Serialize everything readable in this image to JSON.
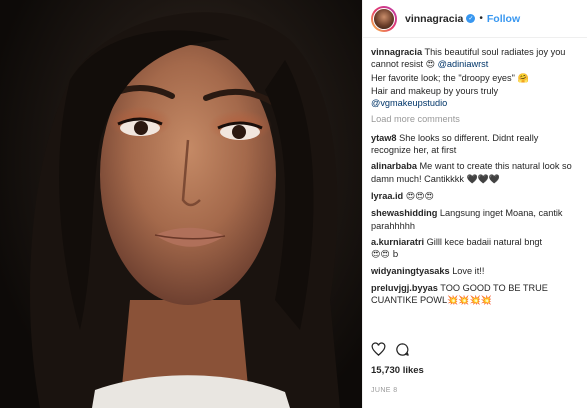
{
  "photo": {
    "alt": "portrait"
  },
  "header": {
    "username": "vinnagracia",
    "dot": "•",
    "follow": "Follow"
  },
  "caption": {
    "username": "vinnagracia",
    "line1": " This beautiful soul radiates joy you cannot resist ",
    "emoji1": "😍",
    "mention": "@adiniawrst",
    "line2": "Her favorite look; the \"droopy eyes\" ",
    "emoji2": "🤗",
    "line3": "Hair and makeup by yours truly",
    "studio": "@vgmakeupstudio"
  },
  "load_more": "Load more comments",
  "comments": [
    {
      "user": "ytaw8",
      "text": " She looks so different. Didnt really recognize her, at first"
    },
    {
      "user": "alinarbaba",
      "text": " Me want to create this natural look so damn much! Cantikkkk ",
      "emoji": "🖤🖤🖤"
    },
    {
      "user": "lyraa.id",
      "text": " ",
      "emoji": "😍😍😍"
    },
    {
      "user": "shewashidding",
      "text": " Langsung inget Moana, cantik parahhhhh"
    },
    {
      "user": "a.kurniaratri",
      "text": " Gilll kece badaii natural bngt ",
      "emoji": "😍😍 b"
    },
    {
      "user": "widyaningtyasaks",
      "text": " Love it!!"
    },
    {
      "user": "preluvjgj.byyas",
      "text": " TOO GOOD TO BE TRUE CUANTIKE POWL",
      "emoji": "💥💥💥💥"
    }
  ],
  "likes": "15,730 likes",
  "date": "JUNE 8"
}
